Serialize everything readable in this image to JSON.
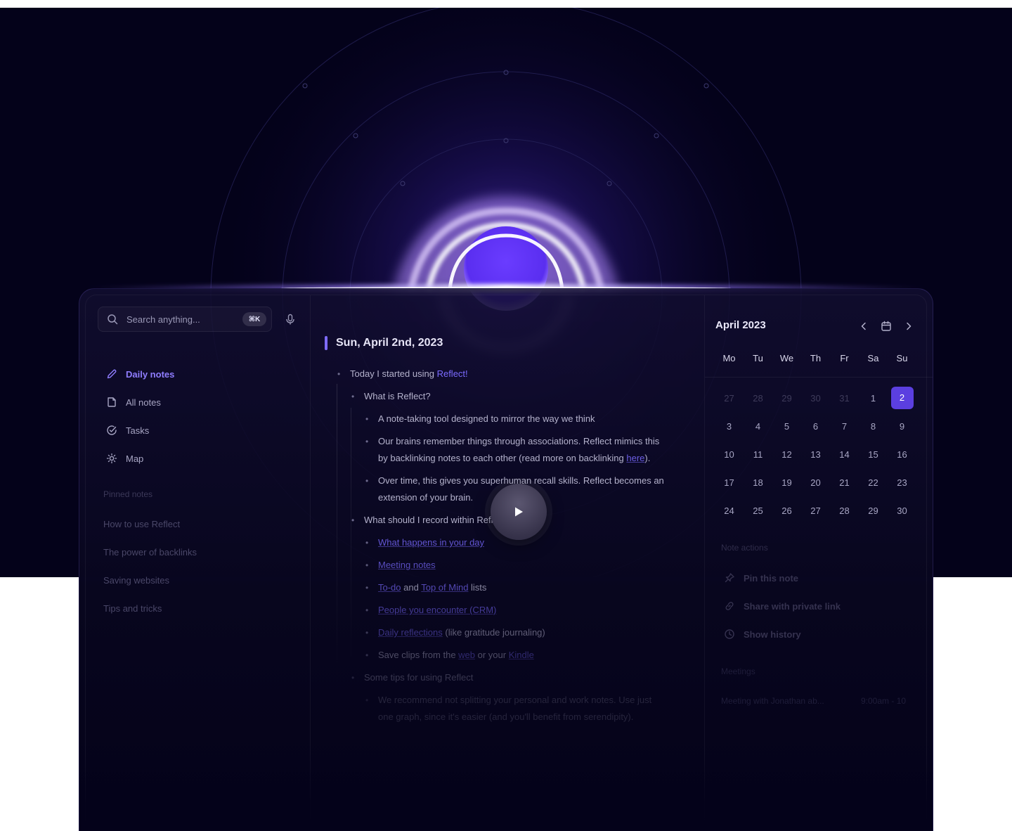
{
  "sidebar": {
    "search": {
      "placeholder": "Search anything...",
      "shortcut": "⌘K",
      "icon": "search-icon",
      "mic_icon": "microphone-icon"
    },
    "nav": [
      {
        "label": "Daily notes",
        "icon": "pencil-icon",
        "active": true
      },
      {
        "label": "All notes",
        "icon": "note-icon",
        "active": false
      },
      {
        "label": "Tasks",
        "icon": "check-circle-icon",
        "active": false
      },
      {
        "label": "Map",
        "icon": "map-sun-icon",
        "active": false
      }
    ],
    "pinned_heading": "Pinned notes",
    "pinned": [
      "How to use Reflect",
      "The power of backlinks",
      "Saving websites",
      "Tips and tricks"
    ]
  },
  "editor": {
    "title": "Sun, April 2nd, 2023",
    "bullets": {
      "b1_pre": "Today I started using ",
      "b1_link": "Reflect!",
      "b2": "What is Reflect?",
      "b3": "A note-taking tool designed to mirror the way we think",
      "b4_line1": "Our brains remember things through associations. Reflect mimics this",
      "b4_line2_pre": "by backlinking notes to each other (read more on backlinking ",
      "b4_link": "here",
      "b4_post": ").",
      "b5_line1": "Over time, this gives you superhuman recall skills. Reflect becomes an",
      "b5_line2": "extension of your brain.",
      "b6": "What should I record within Reflect?",
      "b7": "What happens in your day",
      "b8": "Meeting notes",
      "b9_link1": "To-do",
      "b9_mid": " and ",
      "b9_link2": "Top of Mind",
      "b9_post": " lists",
      "b10": "People you encounter (CRM)",
      "b11_link": "Daily reflections",
      "b11_post": " (like gratitude journaling)",
      "b12_pre": "Save clips from the ",
      "b12_link1": "web",
      "b12_mid": " or your ",
      "b12_link2": "Kindle",
      "b13": "Some tips for using Reflect",
      "b14_line1": "We recommend not splitting your personal and work notes. Use just",
      "b14_line2": "one graph, since it's easier (and you'll benefit from serendipity)."
    },
    "play_icon": "play-icon"
  },
  "calendar": {
    "month": "April 2023",
    "weekdays": [
      "Mo",
      "Tu",
      "We",
      "Th",
      "Fr",
      "Sa",
      "Su"
    ],
    "rows": [
      [
        "27",
        "28",
        "29",
        "30",
        "31",
        "1",
        "2"
      ],
      [
        "3",
        "4",
        "5",
        "6",
        "7",
        "8",
        "9"
      ],
      [
        "10",
        "11",
        "12",
        "13",
        "14",
        "15",
        "16"
      ],
      [
        "17",
        "18",
        "19",
        "20",
        "21",
        "22",
        "23"
      ],
      [
        "24",
        "25",
        "26",
        "27",
        "28",
        "29",
        "30"
      ]
    ],
    "selected": "2",
    "note_actions_heading": "Note actions",
    "note_actions": [
      {
        "label": "Pin this note",
        "icon": "pin-icon"
      },
      {
        "label": "Share with private link",
        "icon": "link-icon"
      },
      {
        "label": "Show history",
        "icon": "clock-icon"
      }
    ],
    "meetings_heading": "Meetings",
    "meeting_title": "Meeting with Jonathan ab...",
    "meeting_time": "9:00am - 10"
  },
  "colors": {
    "accent": "#7e6bff",
    "background": "#04021a",
    "selected_day": "#5b3fe0"
  }
}
